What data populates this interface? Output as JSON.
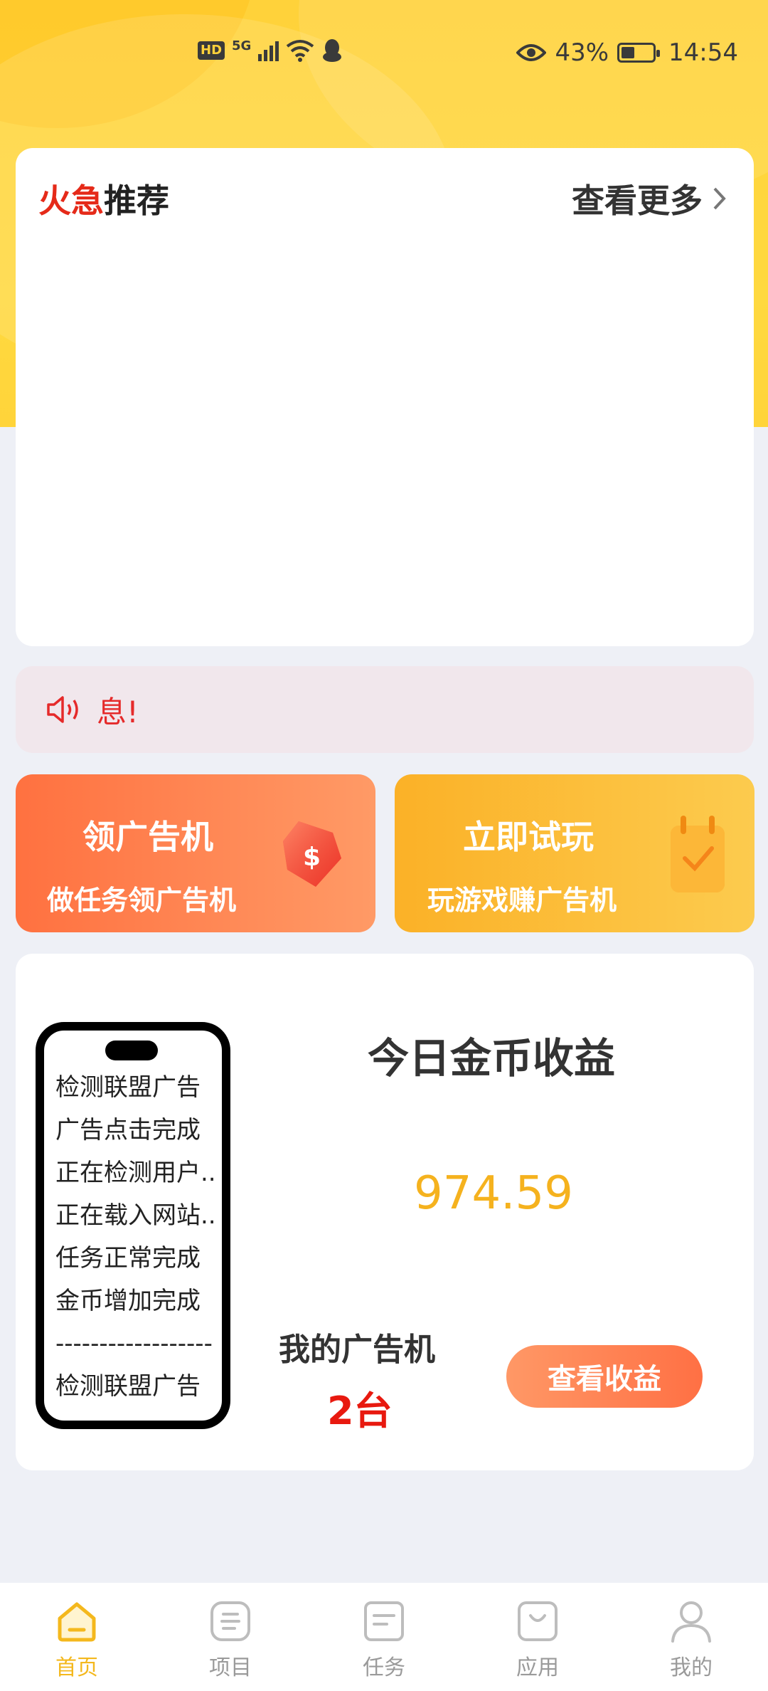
{
  "status_bar": {
    "hd": "HD",
    "network": "5G",
    "battery": "43%",
    "time": "14:54"
  },
  "recommend": {
    "title_hot": "火急",
    "title_rest": "推荐",
    "more_label": "查看更多"
  },
  "notice": {
    "text": "息!"
  },
  "actions": [
    {
      "title": "领广告机",
      "subtitle": "做任务领广告机"
    },
    {
      "title": "立即试玩",
      "subtitle": "玩游戏赚广告机"
    }
  ],
  "earnings": {
    "title": "今日金币收益",
    "value": "974.59",
    "machine_label": "我的广告机",
    "machine_count": "2台",
    "button_label": "查看收益",
    "phone_lines": [
      "检测联盟广告",
      "广告点击完成",
      "正在检测用户..",
      "正在载入网站..",
      "任务正常完成",
      "金币增加完成",
      "------------------",
      "检测联盟广告"
    ]
  },
  "tabs": [
    {
      "label": "首页",
      "icon": "home-icon",
      "active": true
    },
    {
      "label": "项目",
      "icon": "project-icon",
      "active": false
    },
    {
      "label": "任务",
      "icon": "task-icon",
      "active": false
    },
    {
      "label": "应用",
      "icon": "app-bag-icon",
      "active": false
    },
    {
      "label": "我的",
      "icon": "user-icon",
      "active": false
    }
  ],
  "colors": {
    "accent": "#F4B81D",
    "hot_red": "#E52A19",
    "header_yellow": "#FFD93F",
    "earn_gold": "#F5B21E"
  }
}
